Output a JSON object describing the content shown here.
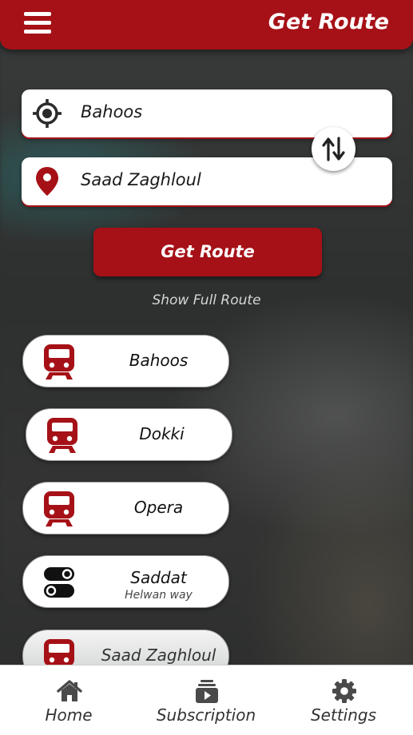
{
  "colors": {
    "brand": "#a51117",
    "surface": "#ffffff",
    "nav_icon": "#4a4a4a"
  },
  "header": {
    "title": "Get Route",
    "menu_icon": "hamburger-menu-icon"
  },
  "route_form": {
    "from": {
      "value": "Bahoos",
      "icon": "location-target-icon"
    },
    "to": {
      "value": "Saad Zaghloul",
      "icon": "map-pin-icon"
    },
    "swap_icon": "swap-vertical-arrows-icon",
    "get_route_label": "Get Route",
    "show_full_route_label": "Show Full Route"
  },
  "stations": [
    {
      "name": "Bahoos",
      "subtitle": "",
      "icon": "metro-train-icon"
    },
    {
      "name": "Dokki",
      "subtitle": "",
      "icon": "metro-train-icon"
    },
    {
      "name": "Opera",
      "subtitle": "",
      "icon": "metro-train-icon"
    },
    {
      "name": "Saddat",
      "subtitle": "Helwan way",
      "icon": "line-change-toggle-icon"
    },
    {
      "name": "Saad Zaghloul",
      "subtitle": "",
      "icon": "metro-train-icon"
    }
  ],
  "bottom_nav": [
    {
      "label": "Home",
      "icon": "home-icon"
    },
    {
      "label": "Subscription",
      "icon": "subscription-icon"
    },
    {
      "label": "Settings",
      "icon": "gear-icon"
    }
  ]
}
